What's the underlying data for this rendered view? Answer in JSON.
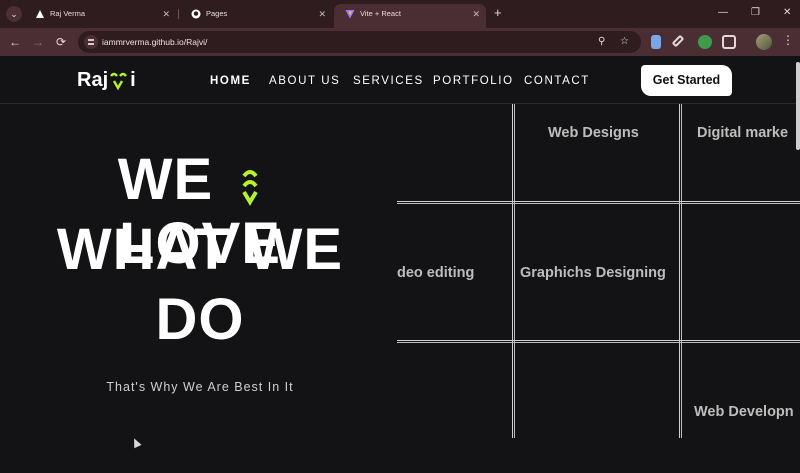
{
  "browser": {
    "tabs": [
      {
        "title": "Raj Verma",
        "active": false
      },
      {
        "title": "Pages",
        "active": false
      },
      {
        "title": "Vite + React",
        "active": true
      }
    ],
    "new_tab_symbol": "+",
    "window_controls": {
      "minimize": "—",
      "restore": "❐",
      "close": "✕"
    },
    "url": "iammrverma.github.io/Rajvi/",
    "icons": {
      "back": "←",
      "forward": "→",
      "reload": "⟳",
      "zoom": "⚲",
      "bookmark": "☆",
      "menu": "⋮"
    }
  },
  "site": {
    "logo_left": "Raj",
    "logo_right": "i",
    "accent_color": "#b6f030",
    "nav": [
      {
        "label": "HOME",
        "active": true
      },
      {
        "label": "ABOUT US",
        "active": false
      },
      {
        "label": "SERVICES",
        "active": false
      },
      {
        "label": "PORTFOLIO",
        "active": false
      },
      {
        "label": "CONTACT",
        "active": false
      }
    ],
    "cta_label": "Get Started"
  },
  "hero": {
    "line1_left": "WE",
    "line1_right": "LOVE",
    "line2": "WHAT WE",
    "line3": "DO",
    "subtitle": "That's Why We Are Best In It"
  },
  "services": {
    "cells": [
      "Web Designs",
      "Digital marke",
      "deo editing",
      "Graphichs Designing",
      "Web Developn"
    ]
  }
}
